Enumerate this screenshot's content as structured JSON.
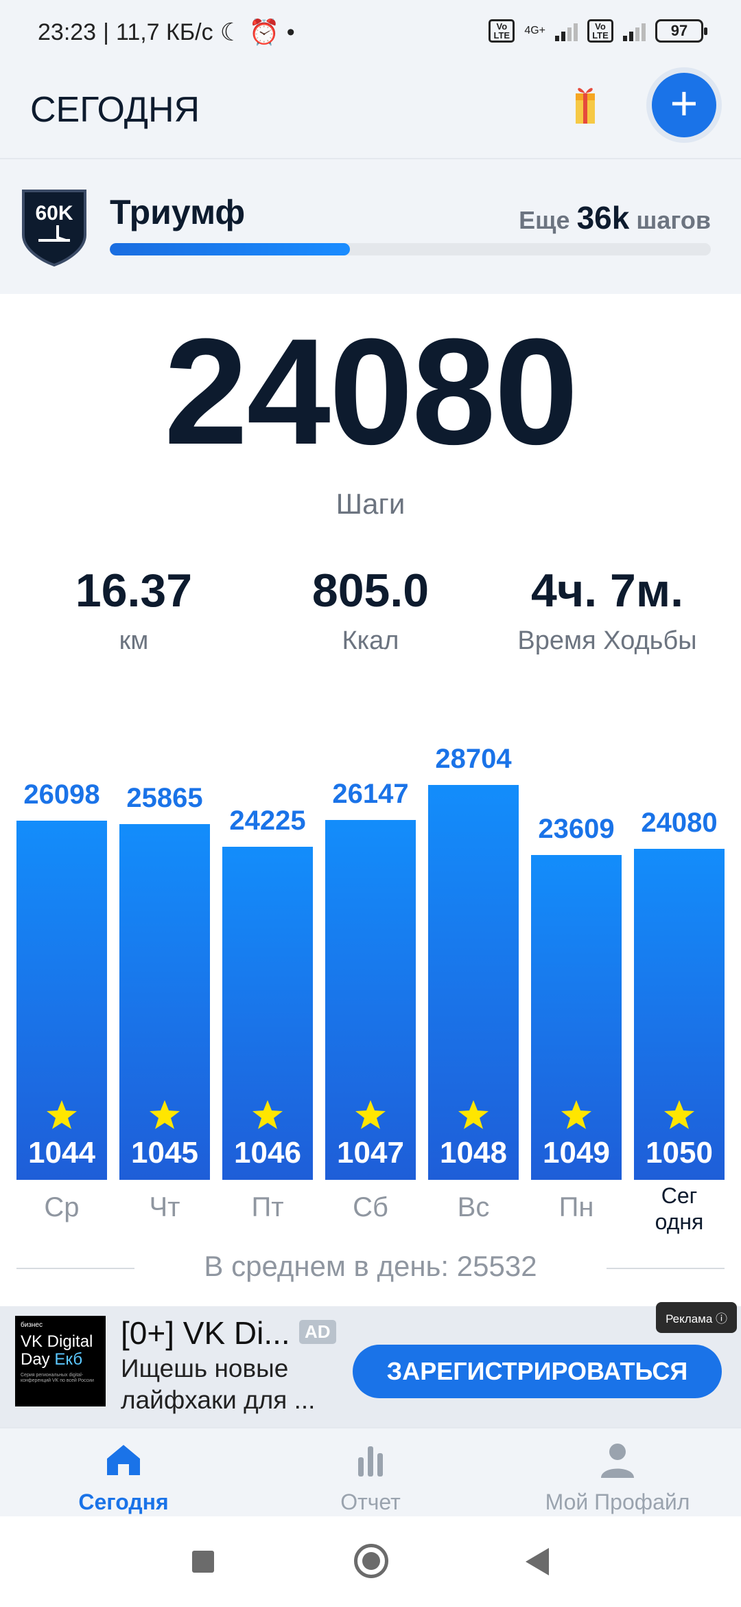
{
  "status_bar": {
    "time": "23:23",
    "speed": "11,7 КБ/с",
    "network": "4G+",
    "volte": "Vo LTE",
    "battery": "97"
  },
  "header": {
    "title": "СЕГОДНЯ"
  },
  "goal": {
    "badge": "60K",
    "name": "Триумф",
    "remaining_prefix": "Еще",
    "remaining_value": "36k",
    "remaining_suffix": "шагов",
    "progress_fraction": 0.4
  },
  "today": {
    "steps": "24080",
    "steps_label": "Шаги"
  },
  "stats": [
    {
      "value": "16.37",
      "label": "км"
    },
    {
      "value": "805.0",
      "label": "Ккал"
    },
    {
      "value": "4ч. 7м.",
      "label": "Время Ходьбы"
    }
  ],
  "chart_data": {
    "type": "bar",
    "categories": [
      "Ср",
      "Чт",
      "Пт",
      "Сб",
      "Вс",
      "Пн",
      "Сег одня"
    ],
    "values": [
      26098,
      25865,
      24225,
      26147,
      28704,
      23609,
      24080
    ],
    "star_counts": [
      1044,
      1045,
      1046,
      1047,
      1048,
      1049,
      1050
    ]
  },
  "average": {
    "text": "В среднем в день: 25532"
  },
  "ad": {
    "image_small": "бизнес",
    "image_line1": "VK Digital",
    "image_line2": "Day",
    "image_accent": "Екб",
    "image_fine": "Серия региональных digital-конференций VK по всей России",
    "title": "[0+] VK Di...",
    "tag": "AD",
    "description": "Ищешь новые лайфхаки для ...",
    "button": "ЗАРЕГИСТРИРОВАТЬСЯ",
    "label": "Реклама ⓘ"
  },
  "tabs": [
    {
      "label": "Сегодня",
      "icon": "home-icon",
      "active": true
    },
    {
      "label": "Отчет",
      "icon": "bar-chart-icon",
      "active": false
    },
    {
      "label": "Мой Профайл",
      "icon": "person-icon",
      "active": false
    }
  ],
  "colors": {
    "accent": "#1a73e8",
    "star": "#ffe600",
    "text_dark": "#0d1b2e",
    "text_muted": "#8f96a0"
  }
}
